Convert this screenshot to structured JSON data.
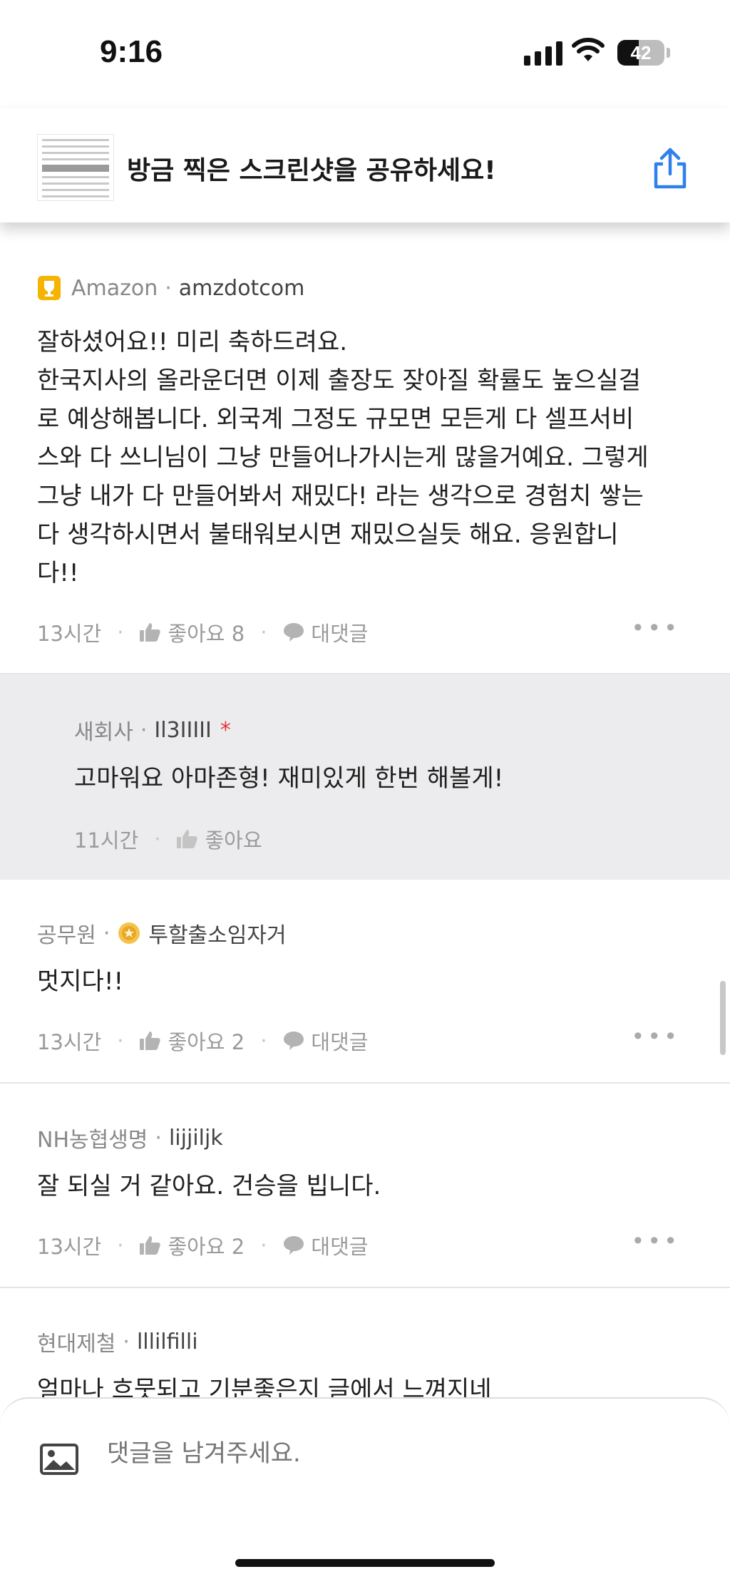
{
  "status_bar": {
    "time": "9:16",
    "battery": "42"
  },
  "share_banner": {
    "title": "방금 찍은 스크린샷을 공유하세요!",
    "icon": "share-icon"
  },
  "comments": [
    {
      "company": "Amazon",
      "author": "amzdotcom",
      "badge": "trophy-icon",
      "text": "잘하셨어요!! 미리 축하드려요.\n한국지사의 올라운더면 이제 출장도 잦아질 확률도 높으실걸\n로 예상해봅니다. 외국계 그정도 규모면 모든게 다 셀프서비\n스와 다 쓰니님이 그냥 만들어나가시는게 많을거예요. 그렇게\n그냥 내가 다 만들어봐서 재밌다! 라는 생각으로 경험치 쌓는\n다 생각하시면서 불태워보시면 재밌으실듯 해요. 응원합니\n다!!",
      "time": "13시간",
      "like_label": "좋아요 8",
      "reply_label": "대댓글"
    },
    {
      "company": "새회사",
      "author": "Il3IIIII",
      "text": "고마워요 아마존형! 재미있게 한번 해볼게!",
      "time": "11시간",
      "like_label": "좋아요"
    },
    {
      "company": "공무원",
      "author": "투할출소임자거",
      "badge": "medal-icon",
      "text": "멋지다!!",
      "time": "13시간",
      "like_label": "좋아요 2",
      "reply_label": "대댓글"
    },
    {
      "company": "NH농협생명",
      "author": "lijjiljk",
      "text": "잘 되실 거 같아요. 건승을 빕니다.",
      "time": "13시간",
      "like_label": "좋아요 2",
      "reply_label": "대댓글"
    },
    {
      "company": "현대제철",
      "author": "lllilfilli",
      "text": "얼마나 흐뭇되고 기분좋은지 글에서 느껴지네"
    }
  ],
  "input": {
    "placeholder": "댓글을 남겨주세요."
  }
}
